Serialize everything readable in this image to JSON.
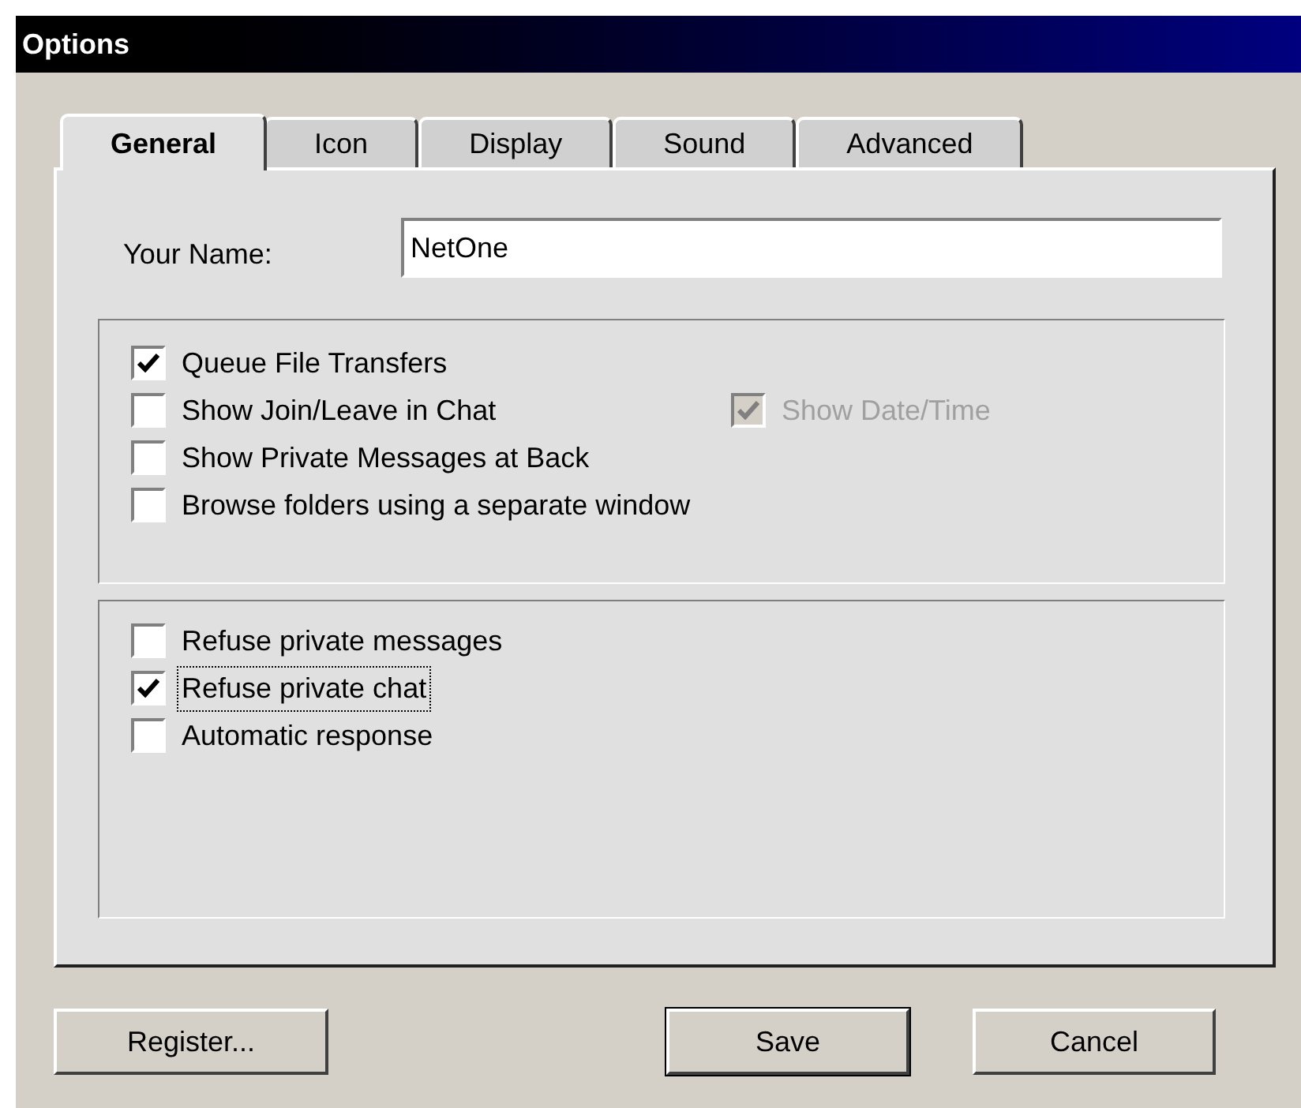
{
  "window": {
    "title": "Options"
  },
  "tabs": [
    {
      "label": "General",
      "selected": true
    },
    {
      "label": "Icon",
      "selected": false
    },
    {
      "label": "Display",
      "selected": false
    },
    {
      "label": "Sound",
      "selected": false
    },
    {
      "label": "Advanced",
      "selected": false
    }
  ],
  "name_field": {
    "label": "Your Name:",
    "value": "NetOne"
  },
  "groups": [
    {
      "rows": [
        [
          {
            "label": "Queue File Transfers",
            "checked": true,
            "disabled": false,
            "focused": false
          }
        ],
        [
          {
            "label": "Show Join/Leave in Chat",
            "checked": false,
            "disabled": false,
            "focused": false
          },
          {
            "label": "Show Date/Time",
            "checked": true,
            "disabled": true,
            "focused": false
          }
        ],
        [
          {
            "label": "Show Private Messages at Back",
            "checked": false,
            "disabled": false,
            "focused": false
          }
        ],
        [
          {
            "label": "Browse folders using a separate window",
            "checked": false,
            "disabled": false,
            "focused": false
          }
        ]
      ]
    },
    {
      "rows": [
        [
          {
            "label": "Refuse private messages",
            "checked": false,
            "disabled": false,
            "focused": false
          }
        ],
        [
          {
            "label": "Refuse private chat",
            "checked": true,
            "disabled": false,
            "focused": true
          }
        ],
        [
          {
            "label": "Automatic response",
            "checked": false,
            "disabled": false,
            "focused": false
          }
        ]
      ]
    }
  ],
  "buttons": [
    {
      "label": "Register...",
      "default": false
    },
    {
      "label": "Save",
      "default": true
    },
    {
      "label": "Cancel",
      "default": false
    }
  ]
}
